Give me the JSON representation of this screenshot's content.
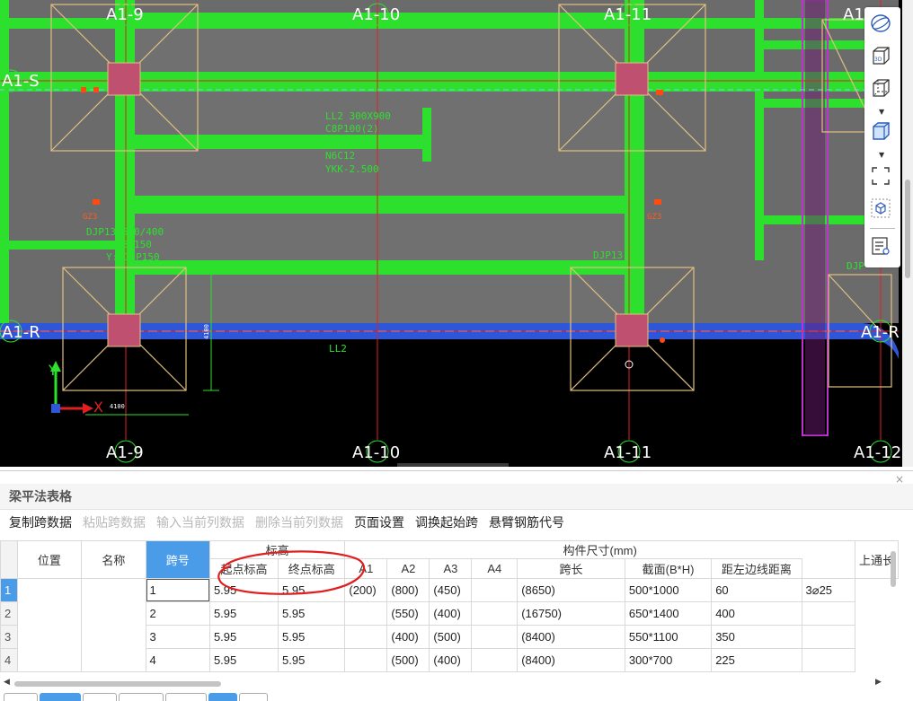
{
  "cad": {
    "axis_top": [
      "A1-9",
      "A1-10",
      "A1-11",
      "A1"
    ],
    "axis_bottom": [
      "A1-9",
      "A1-10",
      "A1-11",
      "A1-12"
    ],
    "axis_left": [
      "A1-S",
      "A1-R"
    ],
    "axis_right": "A1-R",
    "beam_note_1": "LL2 300X900",
    "beam_note_2": "C8P100(2)",
    "beam_note_3": "N6C12",
    "beam_note_4": "YKK-2.500",
    "cap_note_1": "DJP13,550/400",
    "cap_note_2": "B: XC18P150",
    "cap_note_3": "Y:C18P150",
    "cap_note_right": "DJP13",
    "cap_note_far": "DJP",
    "beam_ll2": "LL2",
    "dim_4100": "4100",
    "dim_4100v": "4100",
    "axis_x": "X",
    "axis_y": "Y",
    "gz_labels": [
      "GZ3",
      "GZ3"
    ]
  },
  "toolbar": {
    "icons": [
      "sphere-icon",
      "cube-3d-icon",
      "wireframe-icon",
      "solid-cube-icon",
      "region-select-icon",
      "view-box-icon",
      "properties-icon"
    ]
  },
  "panel": {
    "title": "梁平法表格",
    "close": "×",
    "actions": [
      {
        "label": "复制跨数据",
        "enabled": true
      },
      {
        "label": "粘贴跨数据",
        "enabled": false
      },
      {
        "label": "输入当前列数据",
        "enabled": false
      },
      {
        "label": "删除当前列数据",
        "enabled": false
      },
      {
        "label": "页面设置",
        "enabled": true
      },
      {
        "label": "调换起始跨",
        "enabled": true
      },
      {
        "label": "悬臂钢筋代号",
        "enabled": true
      }
    ]
  },
  "table": {
    "headers": {
      "position": "位置",
      "name": "名称",
      "span": "跨号",
      "elevation_group": "标高",
      "start_elev": "起点标高",
      "end_elev": "终点标高",
      "a1": "A1",
      "a2": "A2",
      "a3": "A3",
      "a4": "A4",
      "size_group": "构件尺寸(mm)",
      "span_len": "跨长",
      "section": "截面(B*H)",
      "left_dist": "距左边线距离",
      "top_through": "上通长"
    },
    "rows": [
      {
        "idx": "1",
        "span": "1",
        "start": "5.95",
        "end": "5.95",
        "a1": "(200)",
        "a2": "(800)",
        "a3": "(450)",
        "a4": "",
        "len": "(8650)",
        "section": "500*1000",
        "dist": "60",
        "top": "3⌀25"
      },
      {
        "idx": "2",
        "span": "2",
        "start": "5.95",
        "end": "5.95",
        "a1": "",
        "a2": "(550)",
        "a3": "(400)",
        "a4": "",
        "len": "(16750)",
        "section": "650*1400",
        "dist": "400",
        "top": ""
      },
      {
        "idx": "3",
        "span": "3",
        "start": "5.95",
        "end": "5.95",
        "a1": "",
        "a2": "(400)",
        "a3": "(500)",
        "a4": "",
        "len": "(8400)",
        "section": "550*1100",
        "dist": "350",
        "top": ""
      },
      {
        "idx": "4",
        "span": "4",
        "start": "5.95",
        "end": "5.95",
        "a1": "",
        "a2": "(500)",
        "a3": "(400)",
        "a4": "",
        "len": "(8400)",
        "section": "300*700",
        "dist": "225",
        "top": ""
      }
    ]
  }
}
